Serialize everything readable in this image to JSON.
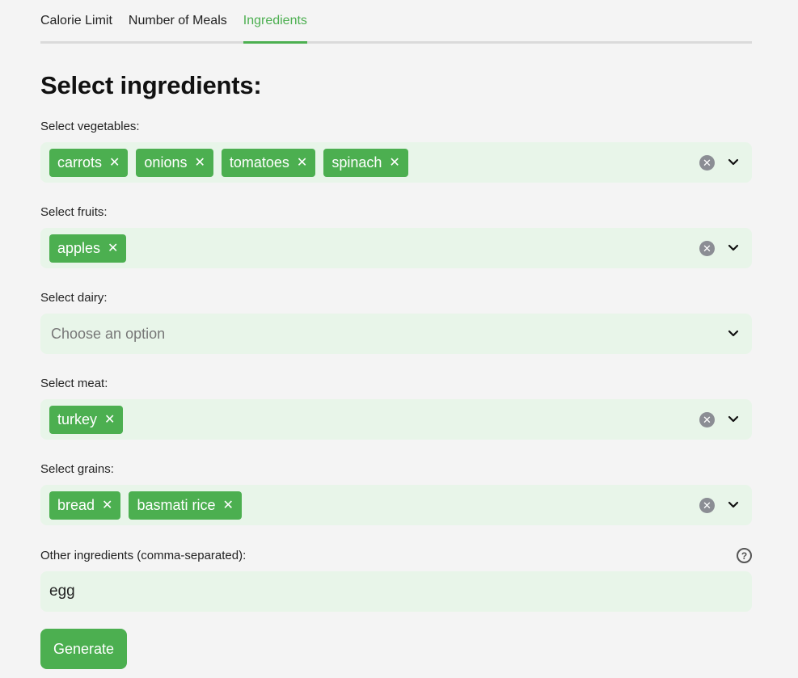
{
  "tabs": [
    {
      "label": "Calorie Limit",
      "active": false
    },
    {
      "label": "Number of Meals",
      "active": false
    },
    {
      "label": "Ingredients",
      "active": true
    }
  ],
  "heading": "Select ingredients:",
  "fields": {
    "vegetables": {
      "label": "Select vegetables:",
      "chips": [
        "carrots",
        "onions",
        "tomatoes",
        "spinach"
      ]
    },
    "fruits": {
      "label": "Select fruits:",
      "chips": [
        "apples"
      ]
    },
    "dairy": {
      "label": "Select dairy:",
      "placeholder": "Choose an option",
      "chips": []
    },
    "meat": {
      "label": "Select meat:",
      "chips": [
        "turkey"
      ]
    },
    "grains": {
      "label": "Select grains:",
      "chips": [
        "bread",
        "basmati rice"
      ]
    }
  },
  "other": {
    "label": "Other ingredients (comma-separated):",
    "value": "egg"
  },
  "generate_label": "Generate",
  "icons": {
    "help": "question-circle-icon",
    "clear": "clear-x-icon",
    "dropdown": "chevron-down-icon"
  },
  "colors": {
    "accent": "#4caf50",
    "input_bg": "#e8f5e9",
    "page_bg": "#f4f4f4"
  }
}
